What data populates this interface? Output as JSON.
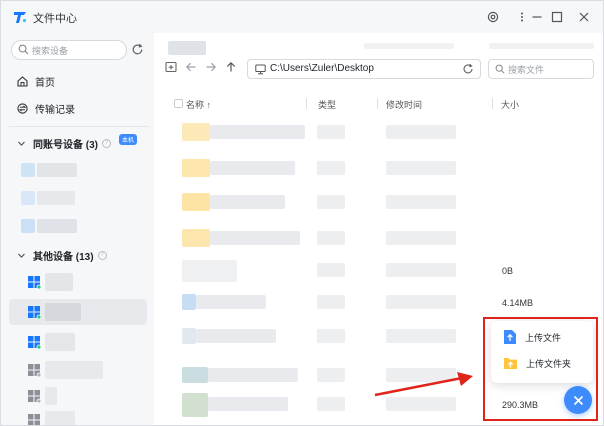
{
  "window": {
    "title": "文件中心"
  },
  "sidebar": {
    "search_placeholder": "搜索设备",
    "nav": [
      {
        "label": "首页",
        "icon": "home-icon"
      },
      {
        "label": "传输记录",
        "icon": "transfer-icon"
      }
    ],
    "group_same_account": {
      "label": "同账号设备 (3)"
    },
    "group_other": {
      "label": "其他设备 (13)"
    },
    "self_badge": "本机"
  },
  "toolbar": {
    "path": "C:\\Users\\Zuler\\Desktop",
    "file_search_placeholder": "搜索文件"
  },
  "table": {
    "columns": [
      "名称",
      "类型",
      "修改时间",
      "大小"
    ],
    "sort_indicator": "↑",
    "visible_sizes": [
      "0B",
      "4.14MB",
      "290.3MB"
    ]
  },
  "upload_menu": {
    "items": [
      {
        "label": "上传文件",
        "icon": "upload-file-icon"
      },
      {
        "label": "上传文件夹",
        "icon": "upload-folder-icon"
      }
    ]
  },
  "colors": {
    "accent": "#3d8bfd",
    "highlight": "#e0241b",
    "folder": "#ffd76e"
  }
}
